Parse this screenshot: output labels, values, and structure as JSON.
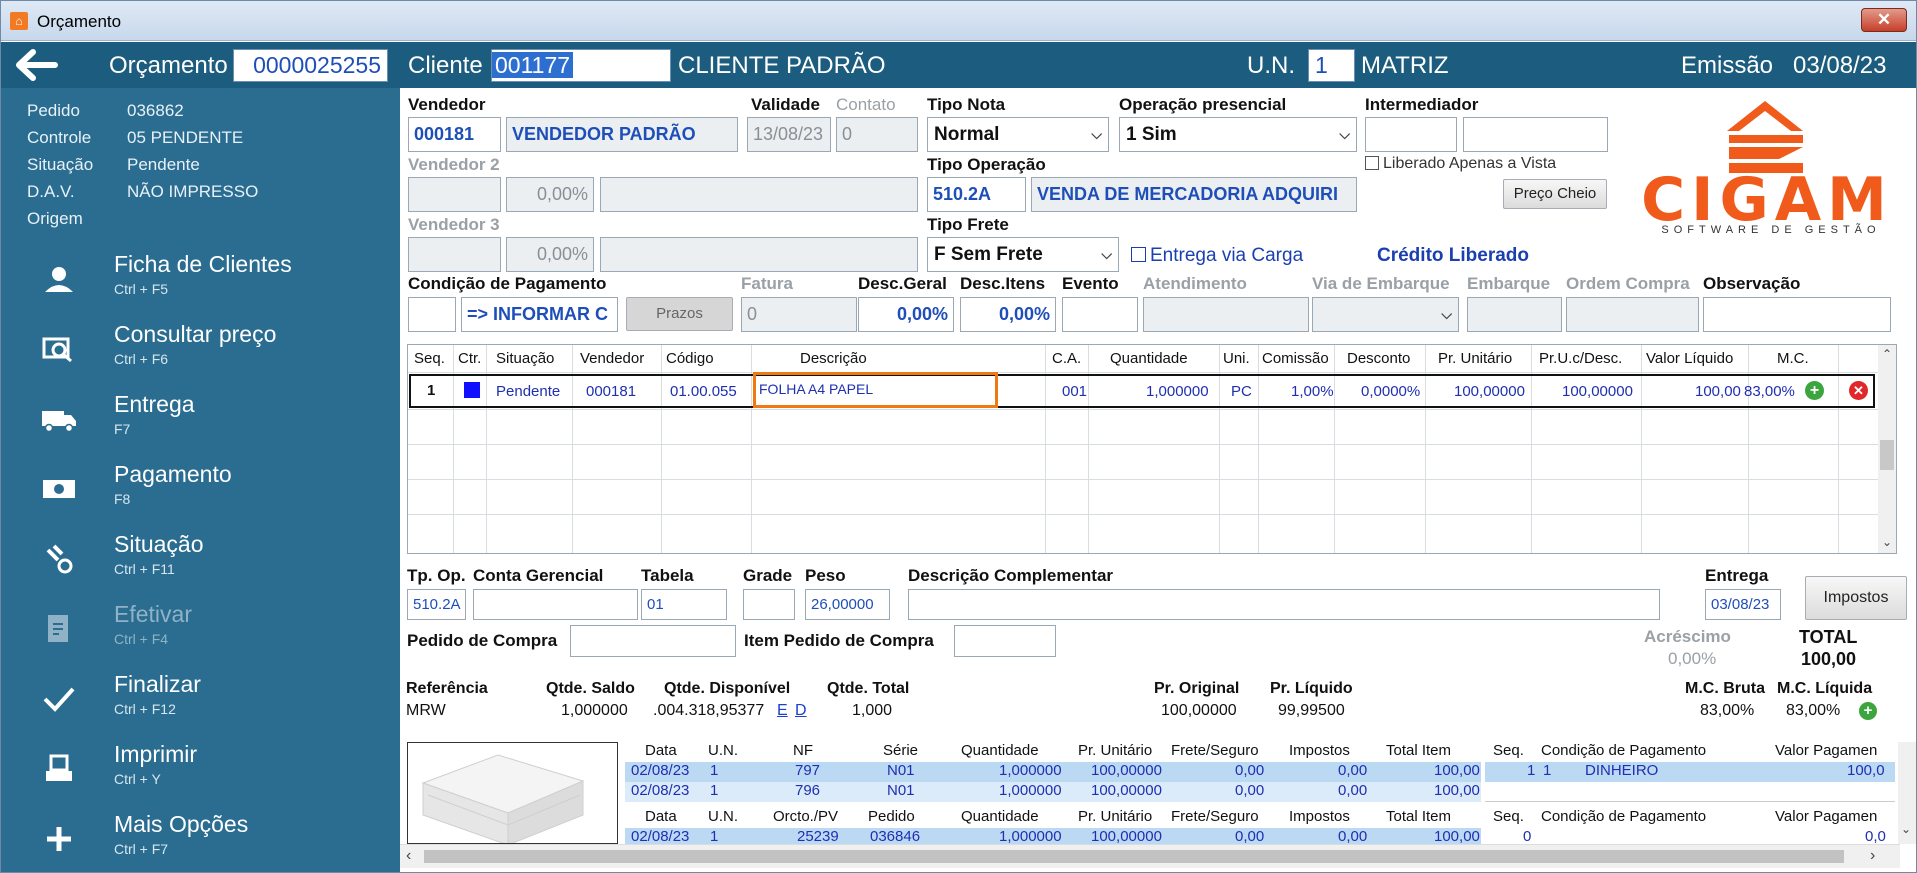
{
  "window": {
    "title": "Orçamento",
    "close": "✕"
  },
  "header": {
    "orc_label": "Orçamento",
    "orc_value": "0000025255",
    "cliente_label": "Cliente",
    "cliente_code": "001177",
    "cliente_name": "CLIENTE PADRÃO",
    "un_label": "U.N.",
    "un_value": "1",
    "un_name": "MATRIZ",
    "emissao_label": "Emissão",
    "emissao_value": "03/08/23"
  },
  "info": {
    "pedido_l": "Pedido",
    "pedido_v": "036862",
    "controle_l": "Controle",
    "controle_v": "05  PENDENTE",
    "situacao_l": "Situação",
    "situacao_v": "Pendente",
    "dav_l": "D.A.V.",
    "dav_v": "NÃO IMPRESSO",
    "origem_l": "Origem"
  },
  "nav": [
    {
      "label": "Ficha de Clientes",
      "key": "Ctrl + F5",
      "icon": "user-card-icon"
    },
    {
      "label": "Consultar preço",
      "key": "Ctrl + F6",
      "icon": "price-search-icon"
    },
    {
      "label": "Entrega",
      "key": "F7",
      "icon": "delivery-truck-icon"
    },
    {
      "label": "Pagamento",
      "key": "F8",
      "icon": "money-icon"
    },
    {
      "label": "Situação",
      "key": "Ctrl + F11",
      "icon": "status-icon"
    },
    {
      "label": "Efetivar",
      "key": "Ctrl + F4",
      "icon": "document-check-icon"
    },
    {
      "label": "Finalizar",
      "key": "Ctrl + F12",
      "icon": "check-icon"
    },
    {
      "label": "Imprimir",
      "key": "Ctrl + Y",
      "icon": "printer-icon"
    },
    {
      "label": "Mais Opções",
      "key": "Ctrl + F7",
      "icon": "plus-icon"
    }
  ],
  "form": {
    "vendedor_l": "Vendedor",
    "vendedor_code": "000181",
    "vendedor_name": "VENDEDOR PADRÃO",
    "validade_l": "Validade",
    "validade_v": "13/08/23",
    "contato_l": "Contato",
    "contato_v": "0",
    "tiponota_l": "Tipo Nota",
    "tiponota_v": "Normal",
    "oppres_l": "Operação presencial",
    "oppres_v": "1 Sim",
    "intermed_l": "Intermediador",
    "vend2_l": "Vendedor 2",
    "vend2_pct": "0,00%",
    "liberado": "Liberado Apenas a Vista",
    "tipoop_l": "Tipo Operação",
    "tipoop_code": "510.2A",
    "tipoop_desc": "VENDA DE MERCADORIA ADQUIRI",
    "preco_cheio": "Preço Cheio",
    "vend3_l": "Vendedor 3",
    "vend3_pct": "0,00%",
    "tipofrete_l": "Tipo Frete",
    "tipofrete_v": "F Sem Frete",
    "entrega_carga": "Entrega via Carga",
    "credito": "Crédito Liberado",
    "condpag_l": "Condição de Pagamento",
    "condpag_v": "=> INFORMAR C",
    "prazos": "Prazos",
    "fatura_l": "Fatura",
    "fatura_v": "0",
    "descgeral_l": "Desc.Geral",
    "descgeral_v": "0,00%",
    "descitens_l": "Desc.Itens",
    "descitens_v": "0,00%",
    "evento_l": "Evento",
    "atend_l": "Atendimento",
    "viaemb_l": "Via de Embarque",
    "embarque_l": "Embarque",
    "ordemcompra_l": "Ordem Compra",
    "obs_l": "Observação"
  },
  "logo": {
    "text": "CIGAM",
    "sub": "SOFTWARE DE GESTÃO",
    "brand_color": "#f05a1a"
  },
  "grid": {
    "headers": [
      "Seq.",
      "Ctr.",
      "Situação",
      "Vendedor",
      "Código",
      "Descrição",
      "C.A.",
      "Quantidade",
      "Uni.",
      "Comissão",
      "Desconto",
      "Pr. Unitário",
      "Pr.U.c/Desc.",
      "Valor Líquido",
      "M.C."
    ],
    "row": [
      "1",
      "",
      "Pendente",
      "000181",
      "01.00.055",
      "FOLHA A4 PAPEL",
      "001",
      "1,000000",
      "PC",
      "1,00%",
      "0,0000%",
      "100,00000",
      "100,00000",
      "100,00",
      "83,00%"
    ]
  },
  "item": {
    "tpop_l": "Tp. Op.",
    "tpop_v": "510.2A",
    "contager_l": "Conta Gerencial",
    "tabela_l": "Tabela",
    "tabela_v": "01",
    "grade_l": "Grade",
    "peso_l": "Peso",
    "peso_v": "26,00000",
    "desccomp_l": "Descrição Complementar",
    "entrega_l": "Entrega",
    "entrega_v": "03/08/23",
    "impostos": "Impostos",
    "pedcompra_l": "Pedido de Compra",
    "itempedcompra_l": "Item Pedido de Compra",
    "acrescimo_l": "Acréscimo",
    "acrescimo_v": "0,00%",
    "total_l": "TOTAL",
    "total_v": "100,00"
  },
  "stats": {
    "ref_l": "Referência",
    "ref_v": "MRW",
    "saldo_l": "Qtde. Saldo",
    "saldo_v": "1,000000",
    "disp_l": "Qtde. Disponível",
    "disp_v": ".004.318,95377",
    "disp_e": "E",
    "disp_d": "D",
    "total_l": "Qtde. Total",
    "total_v": "1,000",
    "prorig_l": "Pr. Original",
    "prorig_v": "100,00000",
    "prliq_l": "Pr. Líquido",
    "prliq_v": "99,99500",
    "mcb_l": "M.C. Bruta",
    "mcb_v": "83,00%",
    "mcl_l": "M.C. Líquida",
    "mcl_v": "83,00%"
  },
  "hist1": {
    "headers": [
      "Data",
      "U.N.",
      "NF",
      "Série",
      "Quantidade",
      "Pr. Unitário",
      "Frete/Seguro",
      "Impostos",
      "Total Item"
    ],
    "rows": [
      [
        "02/08/23",
        "1",
        "797",
        "N01",
        "1,000000",
        "100,00000",
        "0,00",
        "0,00",
        "100,00"
      ],
      [
        "02/08/23",
        "1",
        "796",
        "N01",
        "1,000000",
        "100,00000",
        "0,00",
        "0,00",
        "100,00"
      ]
    ]
  },
  "pay1": {
    "headers": [
      "Seq.",
      "Condição de Pagamento",
      "Valor Pagamen"
    ],
    "row": [
      "1",
      "1",
      "DINHEIRO",
      "100,0"
    ]
  },
  "hist2": {
    "headers": [
      "Data",
      "U.N.",
      "Orcto./PV",
      "Pedido",
      "Quantidade",
      "Pr. Unitário",
      "Frete/Seguro",
      "Impostos",
      "Total Item"
    ],
    "row": [
      "02/08/23",
      "1",
      "25239",
      "036846",
      "1,000000",
      "100,00000",
      "0,00",
      "0,00",
      "100,00"
    ]
  },
  "pay2": {
    "headers": [
      "Seq.",
      "Condição de Pagamento",
      "Valor Pagamen"
    ],
    "row": [
      "0",
      "0,0"
    ]
  }
}
